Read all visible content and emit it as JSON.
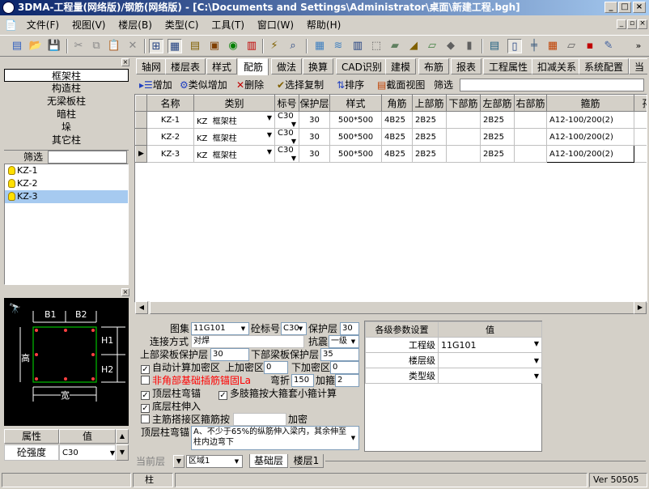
{
  "window": {
    "title": "3DMA-工程量(网络版)/钢筋(网络版) - [C:\\Documents and Settings\\Administrator\\桌面\\新建工程.bgh]",
    "min": "_",
    "max": "□",
    "close": "×"
  },
  "menu": [
    "文件(F)",
    "视图(V)",
    "楼层(B)",
    "类型(C)",
    "工具(T)",
    "窗口(W)",
    "帮助(H)"
  ],
  "toolbar": {
    "more": "»"
  },
  "categories": [
    "框架柱",
    "构造柱",
    "无梁板柱",
    "暗柱",
    "垛",
    "其它柱"
  ],
  "filter_label": "筛选",
  "tree": [
    "KZ-1",
    "KZ-2",
    "KZ-3"
  ],
  "diagram": {
    "b1": "B1",
    "b2": "B2",
    "h1": "H1",
    "h2": "H2",
    "high": "高",
    "width": "宽"
  },
  "props": {
    "col1": "属性",
    "col2": "值",
    "row_label": "砼强度",
    "row_value": "C30"
  },
  "tabs": [
    "轴网",
    "楼层表",
    "样式",
    "配筋",
    "做法",
    "换算",
    "CAD识别",
    "建模",
    "布筋",
    "报表",
    "工程属性",
    "扣减关系",
    "系统配置",
    "当"
  ],
  "actions": {
    "add": "增加",
    "similar_add": "类似增加",
    "delete": "删除",
    "select_copy": "选择复制",
    "sort": "排序",
    "section_view": "截面视图",
    "filter": "筛选"
  },
  "grid": {
    "headers": [
      "名称",
      "类别",
      "标号",
      "保护层",
      "样式",
      "角筋",
      "上部筋",
      "下部筋",
      "左部筋",
      "右部筋",
      "箍筋",
      "孙"
    ],
    "rows": [
      {
        "name": "KZ-1",
        "code": "KZ",
        "cat": "框架柱",
        "grade": "C30",
        "cover": "30",
        "style": "500*500",
        "corner": "4B25",
        "top": "2B25",
        "bottom": "",
        "left": "2B25",
        "right": "",
        "stirrup": "A12-100/200(2)"
      },
      {
        "name": "KZ-2",
        "code": "KZ",
        "cat": "框架柱",
        "grade": "C30",
        "cover": "30",
        "style": "500*500",
        "corner": "4B25",
        "top": "2B25",
        "bottom": "",
        "left": "2B25",
        "right": "",
        "stirrup": "A12-100/200(2)"
      },
      {
        "name": "KZ-3",
        "code": "KZ",
        "cat": "框架柱",
        "grade": "C30",
        "cover": "30",
        "style": "500*500",
        "corner": "4B25",
        "top": "2B25",
        "bottom": "",
        "left": "2B25",
        "right": "",
        "stirrup": "A12-100/200(2)"
      }
    ]
  },
  "form": {
    "atlas_label": "图集",
    "atlas": "11G101",
    "conc_label": "砼标号",
    "conc": "C30",
    "cover_label": "保护层",
    "cover": "30",
    "conn_label": "连接方式",
    "conn": "对焊",
    "seismic_label": "抗震",
    "seismic": "一级",
    "upper_slab_label": "上部梁板保护层",
    "upper_slab": "30",
    "lower_slab_label": "下部梁板保护层",
    "lower_slab": "35",
    "auto_dense_label": "自动计算加密区",
    "upper_dense_label": "上加密区",
    "upper_dense": "0",
    "lower_dense_label": "下加密区",
    "lower_dense": "0",
    "noncorner_label": "非角部基础插筋锚固La",
    "bend_label": "弯折",
    "bend": "150",
    "add_label": "加箍",
    "add": "2",
    "top_bend_label": "顶层柱弯锚",
    "multi_label": "多肢箍按大箍套小箍计算",
    "bottom_extend_label": "底层柱伸入",
    "overlap_label": "主筋搭接区箍筋按",
    "dense_label": "加密",
    "top_anchor_label": "顶层柱弯锚",
    "top_anchor": "A、不少于65%的纵筋伸入梁内，其余伸至柱内边弯下"
  },
  "params": {
    "col1": "各级参数设置",
    "col2": "值",
    "rows": [
      {
        "k": "工程级",
        "v": "11G101"
      },
      {
        "k": "楼层级",
        "v": ""
      },
      {
        "k": "类型级",
        "v": ""
      }
    ]
  },
  "bottom": {
    "floor_label": "当前层",
    "region": "区域1",
    "tab1": "基础层",
    "tab2": "楼层1"
  },
  "status": {
    "cell": "柱",
    "version": "Ver 50505"
  },
  "colors": {
    "accent": "#0a246a",
    "selection": "#a6caf0",
    "red_text": "#ff0000",
    "green_box": "#00c000"
  }
}
